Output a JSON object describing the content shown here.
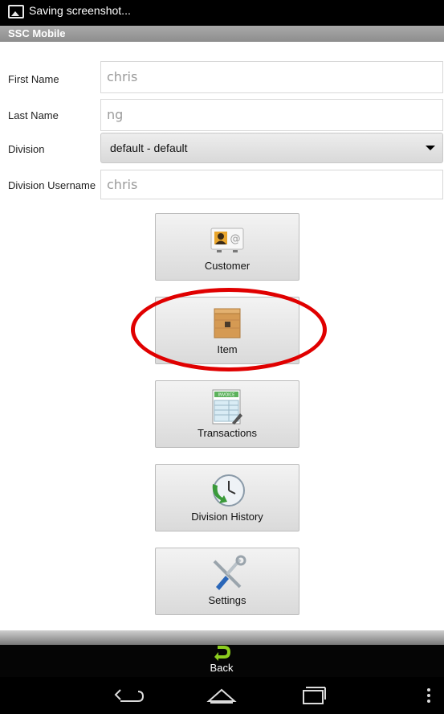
{
  "status_bar": {
    "notification_text": "Saving screenshot...",
    "icon": "picture-icon"
  },
  "app_bar": {
    "title": "SSC Mobile"
  },
  "form": {
    "first_name": {
      "label": "First Name",
      "value": "chris"
    },
    "last_name": {
      "label": "Last Name",
      "value": "ng"
    },
    "division": {
      "label": "Division",
      "selected": "default - default"
    },
    "division_username": {
      "label": "Division Username",
      "value": "chris"
    }
  },
  "menu": [
    {
      "label": "Customer",
      "icon": "customer-card-icon"
    },
    {
      "label": "Item",
      "icon": "item-box-icon"
    },
    {
      "label": "Transactions",
      "icon": "invoice-icon"
    },
    {
      "label": "Division History",
      "icon": "history-clock-icon"
    },
    {
      "label": "Settings",
      "icon": "settings-tools-icon"
    }
  ],
  "invoice_icon_text": "INVOICE",
  "bottom_bar": {
    "back_label": "Back"
  },
  "colors": {
    "highlight": "#e00000",
    "back_arrow": "#8ccd1f",
    "title_bar": "#999999"
  }
}
